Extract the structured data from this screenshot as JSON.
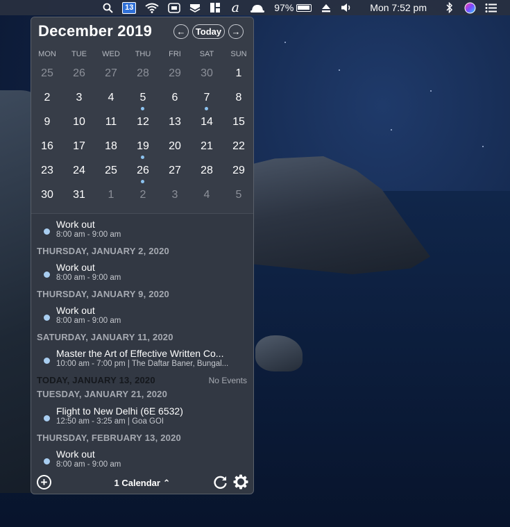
{
  "menubar": {
    "calendar_icon_day": "13",
    "battery": "97%",
    "clock": "Mon 7:52 pm"
  },
  "calendar": {
    "month_title": "December 2019",
    "prev_label": "←",
    "today_label": "Today",
    "next_label": "→",
    "weekdays": [
      "MON",
      "TUE",
      "WED",
      "THU",
      "FRI",
      "SAT",
      "SUN"
    ],
    "weeks": [
      [
        {
          "d": "25",
          "other": true
        },
        {
          "d": "26",
          "other": true
        },
        {
          "d": "27",
          "other": true
        },
        {
          "d": "28",
          "other": true
        },
        {
          "d": "29",
          "other": true
        },
        {
          "d": "30",
          "other": true
        },
        {
          "d": "1"
        }
      ],
      [
        {
          "d": "2"
        },
        {
          "d": "3"
        },
        {
          "d": "4"
        },
        {
          "d": "5",
          "event": true
        },
        {
          "d": "6"
        },
        {
          "d": "7",
          "event": true
        },
        {
          "d": "8"
        }
      ],
      [
        {
          "d": "9"
        },
        {
          "d": "10"
        },
        {
          "d": "11"
        },
        {
          "d": "12"
        },
        {
          "d": "13"
        },
        {
          "d": "14"
        },
        {
          "d": "15"
        }
      ],
      [
        {
          "d": "16"
        },
        {
          "d": "17"
        },
        {
          "d": "18"
        },
        {
          "d": "19",
          "event": true
        },
        {
          "d": "20"
        },
        {
          "d": "21"
        },
        {
          "d": "22"
        }
      ],
      [
        {
          "d": "23"
        },
        {
          "d": "24"
        },
        {
          "d": "25"
        },
        {
          "d": "26",
          "event": true
        },
        {
          "d": "27"
        },
        {
          "d": "28"
        },
        {
          "d": "29"
        }
      ],
      [
        {
          "d": "30"
        },
        {
          "d": "31"
        },
        {
          "d": "1",
          "other": true
        },
        {
          "d": "2",
          "other": true
        },
        {
          "d": "3",
          "other": true
        },
        {
          "d": "4",
          "other": true
        },
        {
          "d": "5",
          "other": true
        }
      ]
    ]
  },
  "agenda": {
    "first_event": {
      "title": "Work out",
      "sub": "8:00 am - 9:00 am"
    },
    "groups": [
      {
        "heading": "THURSDAY, JANUARY 2, 2020",
        "event": {
          "title": "Work out",
          "sub": "8:00 am - 9:00 am"
        }
      },
      {
        "heading": "THURSDAY, JANUARY 9, 2020",
        "event": {
          "title": "Work out",
          "sub": "8:00 am - 9:00 am"
        }
      },
      {
        "heading": "SATURDAY, JANUARY 11, 2020",
        "event": {
          "title": "Master the Art of Effective Written Co...",
          "sub": "10:00 am - 7:00 pm | The Daftar Baner, Bungal..."
        }
      },
      {
        "heading": "TODAY, JANUARY 13, 2020",
        "today": true,
        "no_events": "No Events"
      },
      {
        "heading": "TUESDAY, JANUARY 21, 2020",
        "event": {
          "title": "Flight to New Delhi (6E 6532)",
          "sub": "12:50 am - 3:25 am | Goa GOI"
        }
      },
      {
        "heading": "THURSDAY, FEBRUARY 13, 2020",
        "event": {
          "title": "Work out",
          "sub": "8:00 am - 9:00 am"
        }
      }
    ]
  },
  "footer": {
    "add_label": "+",
    "calendar_selector": "1 Calendar ⌃"
  },
  "colors": {
    "popover_bg": "#323843",
    "event_dot": "#a8cdf0",
    "menubar_calendar": "#2f6fd6"
  }
}
